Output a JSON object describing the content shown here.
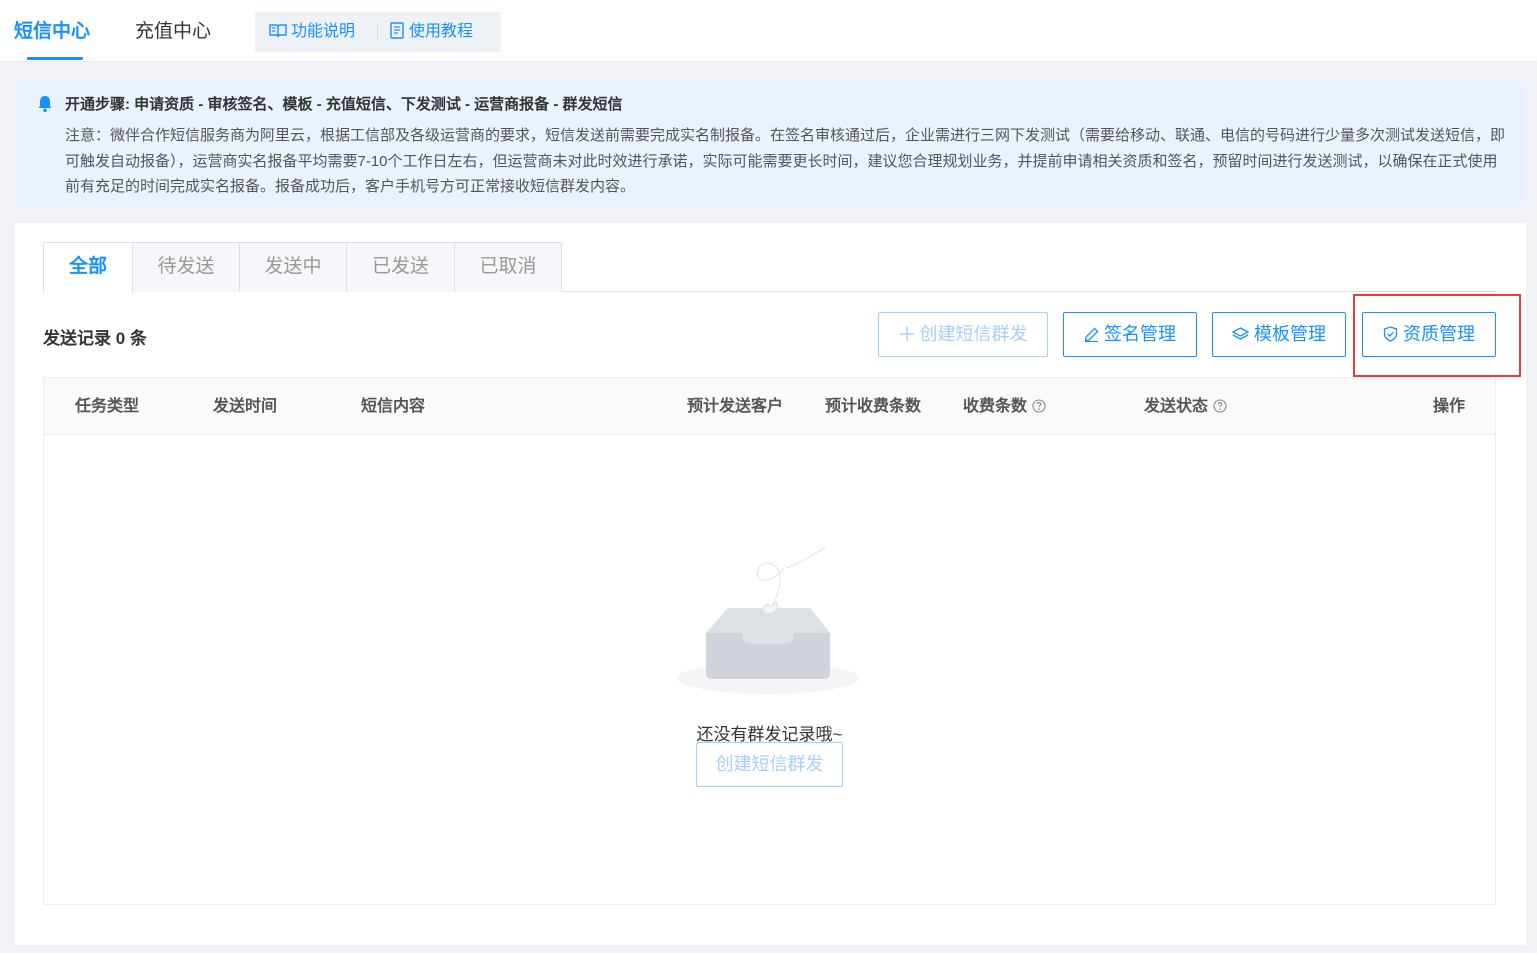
{
  "top_tabs": {
    "sms_center": "短信中心",
    "recharge_center": "充值中心"
  },
  "help_links": {
    "feature_desc": "功能说明",
    "tutorial": "使用教程"
  },
  "notice": {
    "title": "开通步骤: 申请资质 - 审核签名、模板 - 充值短信、下发测试 - 运营商报备 - 群发短信",
    "description": "注意：微伴合作短信服务商为阿里云，根据工信部及各级运营商的要求，短信发送前需要完成实名制报备。在签名审核通过后，企业需进行三网下发测试（需要给移动、联通、电信的号码进行少量多次测试发送短信，即可触发自动报备），运营商实名报备平均需要7-10个工作日左右，但运营商未对此时效进行承诺，实际可能需要更长时间，建议您合理规划业务，并提前申请相关资质和签名，预留时间进行发送测试，以确保在正式使用前有充足的时间完成实名报备。报备成功后，客户手机号方可正常接收短信群发内容。"
  },
  "status_tabs": [
    {
      "label": "全部"
    },
    {
      "label": "待发送"
    },
    {
      "label": "发送中"
    },
    {
      "label": "已发送"
    },
    {
      "label": "已取消"
    }
  ],
  "record_count_text": "发送记录 0 条",
  "actions": {
    "create_bulk_sms": "创建短信群发",
    "signature_mgmt": "签名管理",
    "template_mgmt": "模板管理",
    "qualification_mgmt": "资质管理"
  },
  "table": {
    "columns": [
      "任务类型",
      "发送时间",
      "短信内容",
      "预计发送客户",
      "预计收费条数",
      "收费条数",
      "发送状态",
      "操作"
    ]
  },
  "empty": {
    "text": "还没有群发记录哦~",
    "button": "创建短信群发"
  },
  "colors": {
    "primary": "#1890ff",
    "primary_disabled": "#a3d0fd",
    "highlight": "#e0413b",
    "notice_bg": "#eaf3fd"
  }
}
